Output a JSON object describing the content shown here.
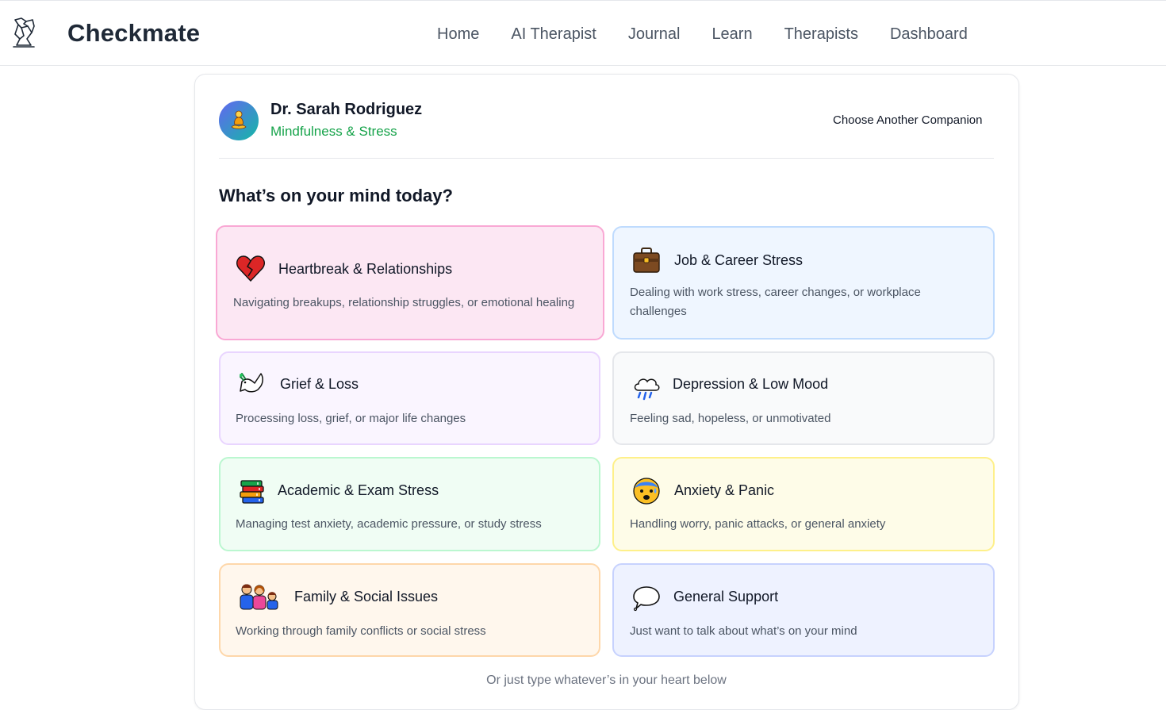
{
  "app": {
    "brand": "Checkmate"
  },
  "nav": {
    "items": [
      "Home",
      "AI Therapist",
      "Journal",
      "Learn",
      "Therapists",
      "Dashboard"
    ]
  },
  "companion": {
    "name": "Dr. Sarah Rodriguez",
    "specialty": "Mindfulness & Stress",
    "choose_label": "Choose Another Companion"
  },
  "prompt": {
    "title": "What’s on your mind today?"
  },
  "topics": [
    {
      "title": "Heartbreak & Relationships",
      "description": "Navigating breakups, relationship struggles, or emotional healing",
      "icon": "broken-heart-icon",
      "color": "#fce7f3",
      "border": "#f9a8d4"
    },
    {
      "title": "Job & Career Stress",
      "description": "Dealing with work stress, career changes, or workplace challenges",
      "icon": "briefcase-icon",
      "color": "#eff6ff",
      "border": "#bfdbfe"
    },
    {
      "title": "Grief & Loss",
      "description": "Processing loss, grief, or major life changes",
      "icon": "dove-icon",
      "color": "#faf5ff",
      "border": "#e9d5ff"
    },
    {
      "title": "Depression & Low Mood",
      "description": "Feeling sad, hopeless, or unmotivated",
      "icon": "rain-cloud-icon",
      "color": "#f9fafb",
      "border": "#e5e7eb"
    },
    {
      "title": "Academic & Exam Stress",
      "description": "Managing test anxiety, academic pressure, or study stress",
      "icon": "books-icon",
      "color": "#f0fdf4",
      "border": "#bbf7d0"
    },
    {
      "title": "Anxiety & Panic",
      "description": "Handling worry, panic attacks, or general anxiety",
      "icon": "anxious-face-icon",
      "color": "#fefce8",
      "border": "#fef08a"
    },
    {
      "title": "Family & Social Issues",
      "description": "Working through family conflicts or social stress",
      "icon": "family-icon",
      "color": "#fff7ed",
      "border": "#fed7aa"
    },
    {
      "title": "General Support",
      "description": "Just want to talk about what’s on your mind",
      "icon": "speech-bubble-icon",
      "color": "#eef2ff",
      "border": "#c7d2fe"
    }
  ],
  "footer": {
    "hint": "Or just type whatever’s in your heart below"
  }
}
